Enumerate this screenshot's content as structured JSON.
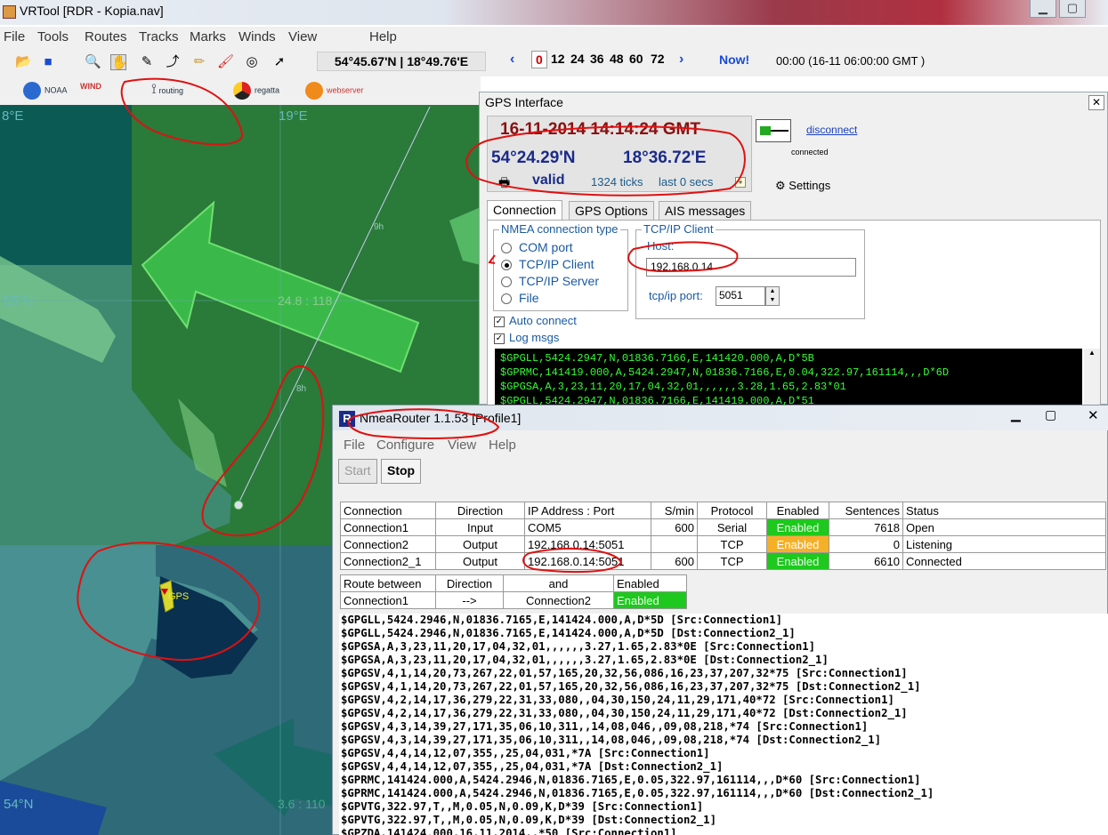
{
  "vrtool": {
    "title": "VRTool [RDR - Kopia.nav]",
    "menu": [
      "File",
      "Tools",
      "Routes",
      "Tracks",
      "Marks",
      "Winds",
      "View",
      "Help"
    ],
    "coordinate_readout": "54°45.67'N | 18°49.76'E",
    "hours": [
      "0",
      "12",
      "24",
      "36",
      "48",
      "60",
      "72"
    ],
    "now_label": "Now!",
    "time_readout": "00:00 (16-11 06:00:00 GMT )",
    "plugins": [
      "NOAA",
      "WIND",
      "routing",
      "regatta",
      "webserver"
    ]
  },
  "map": {
    "lon_top_left": "8°E",
    "lon_top": "19°E",
    "lat_mid": "55°N",
    "lat_bottom": "54°N",
    "wind_label": "24.8 : 118",
    "wind_label_bottom": "3.6 : 110",
    "route_9h": "9h",
    "route_8h": "8h",
    "gps_label": "GPS"
  },
  "gps": {
    "title": "GPS Interface",
    "datetime": "16-11-2014 14:14:24 GMT",
    "lat": "54°24.29'N",
    "lon": "18°36.72'E",
    "validity": "valid",
    "ticks": "1324 ticks",
    "last": "last 0 secs",
    "disconnect_label": "disconnect",
    "connected_label": "connected",
    "settings_label": "Settings",
    "tabs": [
      "Connection",
      "GPS Options",
      "AIS messages"
    ],
    "nmea_group_label": "NMEA connection type",
    "radio_options": [
      "COM port",
      "TCP/IP Client",
      "TCP/IP Server",
      "File"
    ],
    "selected_radio": "TCP/IP Client",
    "tcp_group_label": "TCP/IP Client",
    "host_label": "Host:",
    "host_value": "192.168.0.14",
    "port_label": "tcp/ip port:",
    "port_value": "5051",
    "auto_connect_label": "Auto connect",
    "log_msgs_label": "Log msgs",
    "log_lines": [
      "$GPGLL,5424.2947,N,01836.7166,E,141420.000,A,D*5B",
      "$GPRMC,141419.000,A,5424.2947,N,01836.7166,E,0.04,322.97,161114,,,D*6D",
      "$GPGSA,A,3,23,11,20,17,04,32,01,,,,,,3.28,1.65,2.83*01",
      "$GPGLL,5424.2947,N,01836.7166,E,141419.000,A,D*51"
    ]
  },
  "router": {
    "title": "NmeaRouter 1.1.53  [Profile1]",
    "menu": [
      "File",
      "Configure",
      "View",
      "Help"
    ],
    "start_label": "Start",
    "stop_label": "Stop",
    "conn_headers": [
      "Connection",
      "Direction",
      "IP Address : Port",
      "S/min",
      "Protocol",
      "Enabled",
      "Sentences",
      "Status"
    ],
    "connections": [
      {
        "name": "Connection1",
        "direction": "Input",
        "address": "COM5",
        "smin": "600",
        "protocol": "Serial",
        "enabled": "Enabled",
        "sentences": "7618",
        "status": "Open"
      },
      {
        "name": "Connection2",
        "direction": "Output",
        "address": "192.168.0.14:5051",
        "smin": "",
        "protocol": "TCP",
        "enabled": "Enabled",
        "sentences": "0",
        "status": "Listening"
      },
      {
        "name": "Connection2_1",
        "direction": "Output",
        "address": "192.168.0.14:5051",
        "smin": "600",
        "protocol": "TCP",
        "enabled": "Enabled",
        "sentences": "6610",
        "status": "Connected"
      }
    ],
    "route_headers": [
      "Route between",
      "Direction",
      "and",
      "Enabled"
    ],
    "routes": [
      {
        "from": "Connection1",
        "direction": "-->",
        "to": "Connection2",
        "enabled": "Enabled"
      }
    ],
    "log_lines": [
      "$GPGLL,5424.2946,N,01836.7165,E,141424.000,A,D*5D [Src:Connection1]",
      "$GPGLL,5424.2946,N,01836.7165,E,141424.000,A,D*5D [Dst:Connection2_1]",
      "$GPGSA,A,3,23,11,20,17,04,32,01,,,,,,3.27,1.65,2.83*0E [Src:Connection1]",
      "$GPGSA,A,3,23,11,20,17,04,32,01,,,,,,3.27,1.65,2.83*0E [Dst:Connection2_1]",
      "$GPGSV,4,1,14,20,73,267,22,01,57,165,20,32,56,086,16,23,37,207,32*75 [Src:Connection1]",
      "$GPGSV,4,1,14,20,73,267,22,01,57,165,20,32,56,086,16,23,37,207,32*75 [Dst:Connection2_1]",
      "$GPGSV,4,2,14,17,36,279,22,31,33,080,,04,30,150,24,11,29,171,40*72 [Src:Connection1]",
      "$GPGSV,4,2,14,17,36,279,22,31,33,080,,04,30,150,24,11,29,171,40*72 [Dst:Connection2_1]",
      "$GPGSV,4,3,14,39,27,171,35,06,10,311,,14,08,046,,09,08,218,*74 [Src:Connection1]",
      "$GPGSV,4,3,14,39,27,171,35,06,10,311,,14,08,046,,09,08,218,*74 [Dst:Connection2_1]",
      "$GPGSV,4,4,14,12,07,355,,25,04,031,*7A [Src:Connection1]",
      "$GPGSV,4,4,14,12,07,355,,25,04,031,*7A [Dst:Connection2_1]",
      "$GPRMC,141424.000,A,5424.2946,N,01836.7165,E,0.05,322.97,161114,,,D*60 [Src:Connection1]",
      "$GPRMC,141424.000,A,5424.2946,N,01836.7165,E,0.05,322.97,161114,,,D*60 [Dst:Connection2_1]",
      "$GPVTG,322.97,T,,M,0.05,N,0.09,K,D*39 [Src:Connection1]",
      "$GPVTG,322.97,T,,M,0.05,N,0.09,K,D*39 [Dst:Connection2_1]",
      "$GPZDA,141424.000,16,11,2014,,*50 [Src:Connection1]"
    ]
  },
  "colors": {
    "enabled_green": "#1ec81e",
    "enabled_orange": "#f5b028",
    "annotation_red": "#e01010",
    "gps_datetime": "#8a1010",
    "gps_coords": "#1b2b8a"
  }
}
